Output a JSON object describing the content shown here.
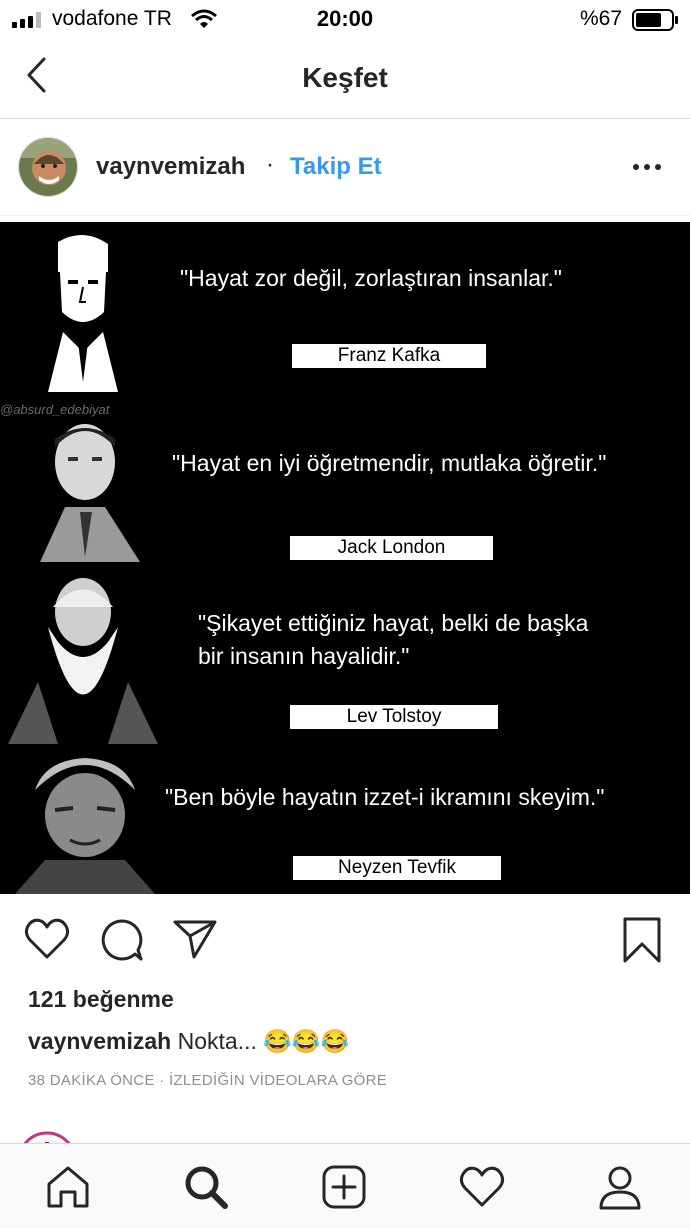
{
  "status_bar": {
    "carrier": "vodafone TR",
    "time": "20:00",
    "battery": "%67"
  },
  "nav": {
    "title": "Keşfet"
  },
  "post": {
    "username": "vaynvemizah",
    "separator": "·",
    "follow_label": "Takip Et",
    "image": {
      "watermark": "@absurd_edebiyat",
      "quotes": [
        {
          "text": "\"Hayat zor değil, zorlaştıran insanlar.\"",
          "author": "Franz Kafka"
        },
        {
          "text": "\"Hayat en iyi öğretmendir, mutlaka öğretir.\"",
          "author": "Jack London"
        },
        {
          "text_line1": "\"Şikayet ettiğiniz hayat, belki de başka",
          "text_line2": "bir insanın hayalidir.\"",
          "author": "Lev Tolstoy"
        },
        {
          "text": "\"Ben böyle hayatın izzet-i ikramını skeyim.\"",
          "author": "Neyzen Tevfik"
        }
      ]
    },
    "likes": "121 beğenme",
    "caption_user": "vaynvemizah",
    "caption_text": "Nokta... 😂😂😂",
    "meta": "38 DAKİKA ÖNCE · İZLEDİĞİN VİDEOLARA GÖRE"
  },
  "icons": {
    "back": "chevron-left-icon",
    "more": "more-horizontal-icon",
    "like": "heart-icon",
    "comment": "comment-icon",
    "share": "paper-plane-icon",
    "save": "bookmark-icon",
    "tabs": [
      "home-icon",
      "search-icon",
      "add-icon",
      "activity-heart-icon",
      "profile-icon"
    ]
  },
  "colors": {
    "link": "#3897f0",
    "text": "#262626",
    "muted": "#8e8e8e"
  }
}
